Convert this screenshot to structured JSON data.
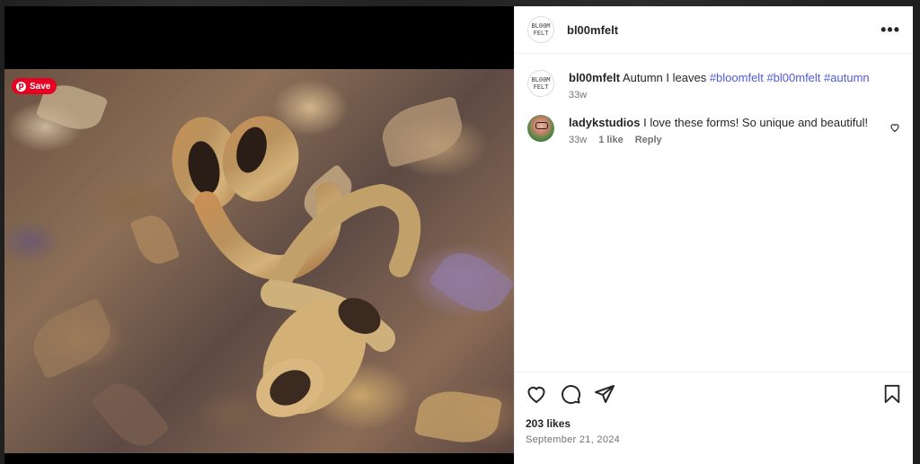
{
  "post": {
    "author": "bl00mfelt",
    "avatar_text_top": "BL00M",
    "avatar_text_bottom": "FELT",
    "more_label": "•••",
    "pin_save_label": "Save",
    "caption": {
      "author": "bl00mfelt",
      "text": "Autumn I leaves",
      "hashtags": [
        "#bloomfelt",
        "#bl00mfelt",
        "#autumn"
      ],
      "age": "33w"
    },
    "comments": [
      {
        "author": "ladykstudios",
        "text": "I love these forms! So unique and beautiful!",
        "age": "33w",
        "likes": "1 like",
        "reply_label": "Reply"
      }
    ],
    "likes": "203 likes",
    "date": "September 21, 2024"
  },
  "icons": [
    "heart-icon",
    "comment-icon",
    "share-icon",
    "bookmark-icon",
    "more-icon",
    "pinterest-icon"
  ],
  "colors": {
    "hashtag": "#4f5bd5",
    "pinterest": "#e60023",
    "text": "#262626",
    "muted": "#737373"
  }
}
